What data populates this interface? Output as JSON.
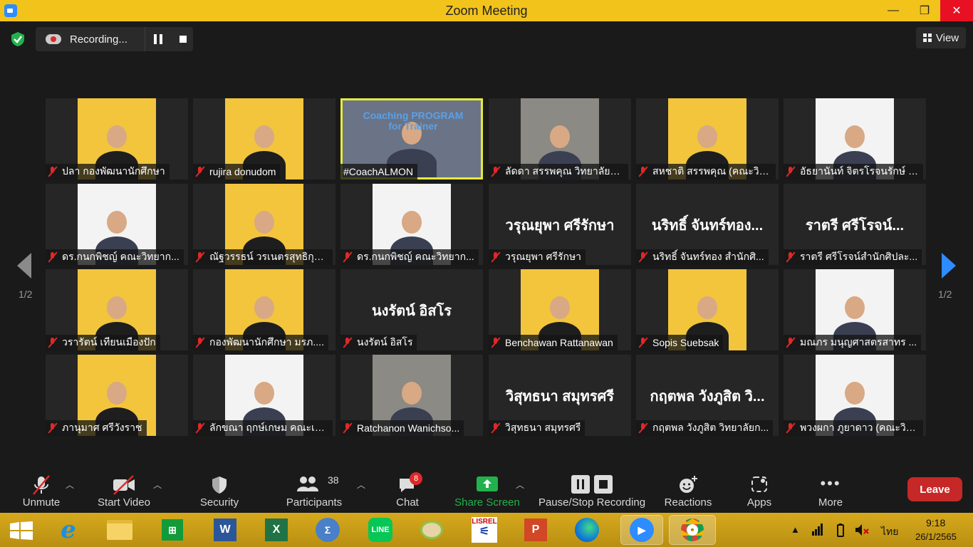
{
  "window": {
    "title": "Zoom Meeting",
    "minimize": "—",
    "maximize": "❐",
    "close": "✕"
  },
  "topbar": {
    "recording_label": "Recording...",
    "view_label": "View"
  },
  "pagination": {
    "left": "1/2",
    "right": "1/2"
  },
  "participants": [
    {
      "label": "ปลา กองพัฒนานักศึกษา",
      "type": "yellow"
    },
    {
      "label": "rujira donudom",
      "type": "yellow"
    },
    {
      "label": "#CoachALMON",
      "type": "photo",
      "active": true,
      "overlay": "Coaching PROGRAM for Trainer"
    },
    {
      "label": "ลัดดา สรรพคุณ วิทยาลัยก...",
      "type": "photo"
    },
    {
      "label": "สหชาติ สรรพคุณ (คณะวิท...",
      "type": "yellow"
    },
    {
      "label": "อัธยานันท์ จิตรโรจนรักษ์ ค...",
      "type": "white"
    },
    {
      "label": "ดร.กนกพิชญ์ คณะวิทยาก...",
      "type": "white"
    },
    {
      "label": "ณัฐวรรธน์ วรเนตรสุทธิกุล ...",
      "type": "yellow"
    },
    {
      "label": "ดร.กนกพิชญ์ คณะวิทยาก...",
      "type": "white"
    },
    {
      "label": "วรุณยุพา ศรีรักษา",
      "type": "name",
      "big": "วรุณยุพา ศรีรักษา"
    },
    {
      "label": "นริทธิ์ จันทร์ทอง สำนักศิ...",
      "type": "name",
      "big": "นริทธิ์ จันทร์ทอง..."
    },
    {
      "label": "ราตรี   ศรีโรจน์สำนักศิปละ...",
      "type": "name",
      "big": "ราตรี   ศรีโรจน์..."
    },
    {
      "label": "วรารัตน์ เทียนเมืองปัก",
      "type": "yellow"
    },
    {
      "label": "กองพัฒนานักศึกษา มรภ....",
      "type": "yellow"
    },
    {
      "label": "นงรัตน์ อิสโร",
      "type": "name",
      "big": "นงรัตน์ อิสโร"
    },
    {
      "label": "Benchawan Rattanawan",
      "type": "yellow"
    },
    {
      "label": "Sopis Suebsak",
      "type": "yellow"
    },
    {
      "label": "มณภร มนุญศาสตรสาทร ...",
      "type": "white"
    },
    {
      "label": "ภานุมาศ ศรีวังราช",
      "type": "yellow"
    },
    {
      "label": "ลักขณา ฤกษ์เกษม คณะเท...",
      "type": "white"
    },
    {
      "label": "Ratchanon Wanichso...",
      "type": "photo"
    },
    {
      "label": "วิสุทธนา สมุทรศรี",
      "type": "name",
      "big": "วิสุทธนา สมุทรศรี"
    },
    {
      "label": "กฤตพล วังภูสิต วิทยาลัยก...",
      "type": "name",
      "big": "กฤตพล วังภูสิต วิ..."
    },
    {
      "label": "พวงผกา ภูยาดาว (คณะวิท...",
      "type": "white"
    }
  ],
  "toolbar": {
    "unmute": "Unmute",
    "start_video": "Start Video",
    "security": "Security",
    "participants": "Participants",
    "participants_count": "38",
    "chat": "Chat",
    "chat_badge": "8",
    "share_screen": "Share Screen",
    "pause_stop": "Pause/Stop Recording",
    "reactions": "Reactions",
    "apps": "Apps",
    "more": "More",
    "leave": "Leave"
  },
  "taskbar": {
    "lang": "ไทย",
    "time": "9:18",
    "date": "26/1/2565",
    "apps": [
      "start",
      "internet-explorer",
      "file-explorer",
      "store",
      "word",
      "excel",
      "calculator",
      "line",
      "paint",
      "lisrel",
      "powerpoint",
      "edge",
      "zoom",
      "chrome"
    ]
  },
  "colors": {
    "accent": "#2d8cff",
    "titlebar": "#f2c31b",
    "active_speaker": "#e6ea3a",
    "leave": "#c62828",
    "share": "#22b14c"
  }
}
